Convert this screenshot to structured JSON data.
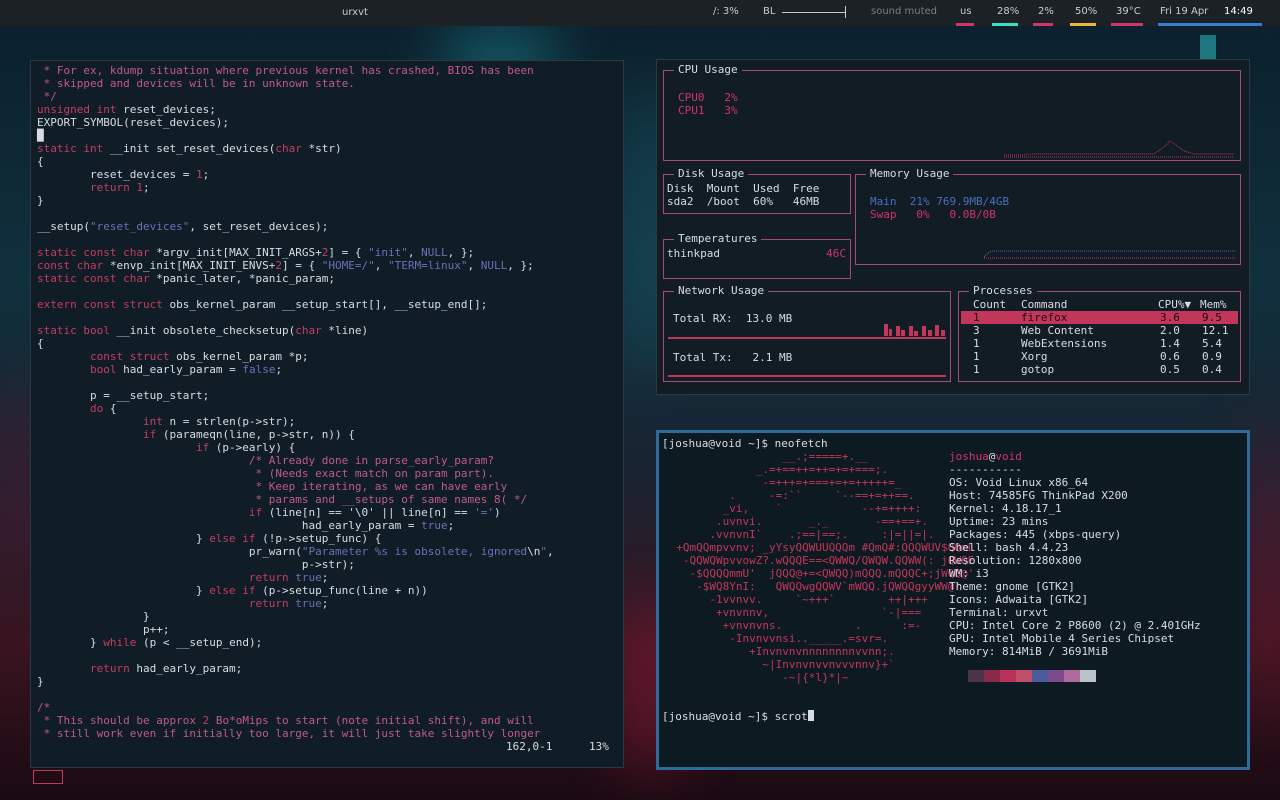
{
  "bar": {
    "window_title": "urxvt",
    "disk": "/: 3%",
    "bl_label": "BL",
    "sound": "sound muted",
    "layout": "us",
    "cpu1": "28%",
    "cpu2": "2%",
    "bat": "50%",
    "temp": "39°C",
    "date": "Fri 19 Apr",
    "time": "14:49"
  },
  "vim": {
    "lines": [
      [
        [
          "c-com",
          " * For ex, kdump situation where previous kernel has crashed, BIOS has been"
        ]
      ],
      [
        [
          "c-com",
          " * skipped and devices will be in unknown state."
        ]
      ],
      [
        [
          "c-com",
          " */"
        ]
      ],
      [
        [
          "c-kw",
          "unsigned int"
        ],
        [
          "c-plain",
          " reset_devices;"
        ]
      ],
      [
        [
          "c-plain",
          "EXPORT_SYMBOL(reset_devices);"
        ]
      ],
      [
        [
          "c-plain",
          "█"
        ]
      ],
      [
        [
          "c-kw",
          "static int"
        ],
        [
          "c-plain",
          " __init set_reset_devices("
        ],
        [
          "c-kw",
          "char"
        ],
        [
          "c-plain",
          " *str)"
        ]
      ],
      [
        [
          "c-plain",
          "{"
        ]
      ],
      [
        [
          "c-plain",
          "        reset_devices = "
        ],
        [
          "c-num",
          "1"
        ],
        [
          "c-plain",
          ";"
        ]
      ],
      [
        [
          "c-kw",
          "        return "
        ],
        [
          "c-num",
          "1"
        ],
        [
          "c-plain",
          ";"
        ]
      ],
      [
        [
          "c-plain",
          "}"
        ]
      ],
      [
        [
          "c-plain",
          ""
        ]
      ],
      [
        [
          "c-plain",
          "__setup("
        ],
        [
          "c-str",
          "\"reset_devices\""
        ],
        [
          "c-plain",
          ", set_reset_devices);"
        ]
      ],
      [
        [
          "c-plain",
          ""
        ]
      ],
      [
        [
          "c-kw",
          "static const char"
        ],
        [
          "c-plain",
          " *argv_init[MAX_INIT_ARGS+"
        ],
        [
          "c-num",
          "2"
        ],
        [
          "c-plain",
          "] = { "
        ],
        [
          "c-str",
          "\"init\""
        ],
        [
          "c-plain",
          ", "
        ],
        [
          "c-str",
          "NULL"
        ],
        [
          "c-plain",
          ", };"
        ]
      ],
      [
        [
          "c-kw",
          "const char"
        ],
        [
          "c-plain",
          " *envp_init[MAX_INIT_ENVS+"
        ],
        [
          "c-num",
          "2"
        ],
        [
          "c-plain",
          "] = { "
        ],
        [
          "c-str",
          "\"HOME=/\""
        ],
        [
          "c-plain",
          ", "
        ],
        [
          "c-str",
          "\"TERM=linux\""
        ],
        [
          "c-plain",
          ", "
        ],
        [
          "c-str",
          "NULL"
        ],
        [
          "c-plain",
          ", };"
        ]
      ],
      [
        [
          "c-kw",
          "static const char"
        ],
        [
          "c-plain",
          " *panic_later, *panic_param;"
        ]
      ],
      [
        [
          "c-plain",
          ""
        ]
      ],
      [
        [
          "c-kw",
          "extern const struct"
        ],
        [
          "c-plain",
          " obs_kernel_param __setup_start[], __setup_end[];"
        ]
      ],
      [
        [
          "c-plain",
          ""
        ]
      ],
      [
        [
          "c-kw",
          "static bool"
        ],
        [
          "c-plain",
          " __init obsolete_checksetup("
        ],
        [
          "c-kw",
          "char"
        ],
        [
          "c-plain",
          " *line)"
        ]
      ],
      [
        [
          "c-plain",
          "{"
        ]
      ],
      [
        [
          "c-kw",
          "        const struct"
        ],
        [
          "c-plain",
          " obs_kernel_param *p;"
        ]
      ],
      [
        [
          "c-kw",
          "        bool"
        ],
        [
          "c-plain",
          " had_early_param = "
        ],
        [
          "c-str",
          "false"
        ],
        [
          "c-plain",
          ";"
        ]
      ],
      [
        [
          "c-plain",
          ""
        ]
      ],
      [
        [
          "c-plain",
          "        p = __setup_start;"
        ]
      ],
      [
        [
          "c-kw",
          "        do"
        ],
        [
          "c-plain",
          " {"
        ]
      ],
      [
        [
          "c-kw",
          "                int"
        ],
        [
          "c-plain",
          " n = strlen(p->str);"
        ]
      ],
      [
        [
          "c-kw",
          "                if"
        ],
        [
          "c-plain",
          " (parameqn(line, p->str, n)) {"
        ]
      ],
      [
        [
          "c-kw",
          "                        if"
        ],
        [
          "c-plain",
          " (p->early) {"
        ]
      ],
      [
        [
          "c-com",
          "                                /* Already done in parse_early_param?"
        ]
      ],
      [
        [
          "c-com",
          "                                 * (Needs exact match on param part)."
        ]
      ],
      [
        [
          "c-com",
          "                                 * Keep iterating, as we can have early"
        ]
      ],
      [
        [
          "c-com",
          "                                 * params and __setups of same names 8( */"
        ]
      ],
      [
        [
          "c-kw",
          "                                if"
        ],
        [
          "c-plain",
          " (line[n] == "
        ],
        [
          "c-plain",
          "'\\0'"
        ],
        [
          "c-plain",
          " || line[n] == "
        ],
        [
          "c-str",
          "'='"
        ],
        [
          "c-plain",
          ")"
        ]
      ],
      [
        [
          "c-plain",
          "                                        had_early_param = "
        ],
        [
          "c-str",
          "true"
        ],
        [
          "c-plain",
          ";"
        ]
      ],
      [
        [
          "c-plain",
          "                        } "
        ],
        [
          "c-kw",
          "else if"
        ],
        [
          "c-plain",
          " (!p->setup_func) {"
        ]
      ],
      [
        [
          "c-plain",
          "                                pr_warn("
        ],
        [
          "c-str",
          "\"Parameter %s is obsolete, ignored"
        ],
        [
          "c-plain",
          "\\n"
        ],
        [
          "c-str",
          "\""
        ],
        [
          "c-plain",
          ","
        ]
      ],
      [
        [
          "c-plain",
          "                                        p->str);"
        ]
      ],
      [
        [
          "c-kw",
          "                                return "
        ],
        [
          "c-str",
          "true"
        ],
        [
          "c-plain",
          ";"
        ]
      ],
      [
        [
          "c-plain",
          "                        } "
        ],
        [
          "c-kw",
          "else if"
        ],
        [
          "c-plain",
          " (p->setup_func(line + n))"
        ]
      ],
      [
        [
          "c-kw",
          "                                return "
        ],
        [
          "c-str",
          "true"
        ],
        [
          "c-plain",
          ";"
        ]
      ],
      [
        [
          "c-plain",
          "                }"
        ]
      ],
      [
        [
          "c-plain",
          "                p++;"
        ]
      ],
      [
        [
          "c-plain",
          "        } "
        ],
        [
          "c-kw",
          "while"
        ],
        [
          "c-plain",
          " (p < __setup_end);"
        ]
      ],
      [
        [
          "c-plain",
          ""
        ]
      ],
      [
        [
          "c-kw",
          "        return"
        ],
        [
          "c-plain",
          " had_early_param;"
        ]
      ],
      [
        [
          "c-plain",
          "}"
        ]
      ],
      [
        [
          "c-plain",
          ""
        ]
      ],
      [
        [
          "c-com",
          "/*"
        ]
      ],
      [
        [
          "c-com",
          " * This should be approx "
        ],
        [
          "c-num",
          "2"
        ],
        [
          "c-com",
          " Bo*oMips to start (note initial shift), and will"
        ]
      ],
      [
        [
          "c-com",
          " * still work even if initially too large, it will just take slightly longer"
        ]
      ]
    ],
    "status_pos": "162,0-1",
    "status_pct": "13%"
  },
  "gotop": {
    "cpu_label": "CPU Usage",
    "cpu_rows": [
      "CPU0   2%",
      "CPU1   3%"
    ],
    "disk_label": "Disk Usage",
    "disk_header": "Disk  Mount  Used  Free",
    "disk_row": "sda2  /boot  60%   46MB",
    "mem_label": "Memory Usage",
    "mem_main": "Main  21% 769.9MB/4GB",
    "mem_swap": "Swap   0%   0.0B/0B",
    "temp_label": "Temperatures",
    "temp_name": "thinkpad",
    "temp_val": "46C",
    "net_label": "Network Usage",
    "rx": "Total RX:  13.0 MB",
    "tx": "Total Tx:   2.1 MB",
    "proc_label": "Processes",
    "proc_header": {
      "count": "Count",
      "cmd": "Command",
      "cpu": "CPU%▼",
      "mem": "Mem%"
    },
    "procs": [
      {
        "count": "1",
        "cmd": "firefox",
        "cpu": "3.6",
        "mem": "9.5"
      },
      {
        "count": "3",
        "cmd": "Web Content",
        "cpu": "2.0",
        "mem": "12.1"
      },
      {
        "count": "1",
        "cmd": "WebExtensions",
        "cpu": "1.4",
        "mem": "5.4"
      },
      {
        "count": "1",
        "cmd": "Xorg",
        "cpu": "0.6",
        "mem": "0.9"
      },
      {
        "count": "1",
        "cmd": "gotop",
        "cpu": "0.5",
        "mem": "0.4"
      }
    ]
  },
  "neofetch": {
    "prompt1": "[joshua@void ~]$ neofetch",
    "user": "joshua",
    "at": "@",
    "host": "void",
    "sep": "-----------",
    "info": [
      "OS: Void Linux x86_64",
      "Host: 74585FG ThinkPad X200",
      "Kernel: 4.18.17_1",
      "Uptime: 23 mins",
      "Packages: 445 (xbps-query)",
      "Shell: bash 4.4.23",
      "Resolution: 1280x800",
      "WM: i3",
      "Theme: gnome [GTK2]",
      "Icons: Adwaita [GTK2]",
      "Terminal: urxvt",
      "CPU: Intel Core 2 P8600 (2) @ 2.401GHz",
      "GPU: Intel Mobile 4 Series Chipset",
      "Memory: 814MiB / 3691MiB"
    ],
    "ascii": [
      "                  __.;=====+.__",
      "              _.=+==++=++=+=+===;.",
      "               -=+++=+===+=+=+++++=_",
      "          .     -=:``     `--==+=++==.",
      "         _vi,    `            --+=++++:",
      "        .uvnvi.       _._       -==+==+.",
      "       .vvnvnI`    .;==|==;.     :|=||=|.",
      "  +QmQQmpvvnv; _yYsyQQWUUQQQm #QmQ#:QQQWUV$QQmL",
      "   -QQWQWpvvowZ?.wQQQE==<QWWQ/QWQW.QQWW(: jQWQE",
      "    -$QQQQmmU'  jQQQ@+=<QWQQ)mQQQ.mQQQC+;jWQQ@'",
      "     -$WQ8YnI:   QWQQwgQQWV`mWQQ.jQWQQgyyWW@!",
      "       -1vvnvv.     `~+++`        ++|+++",
      "        +vnvnnv,                 `-|===",
      "         +vnvnvns.           .      :=-",
      "          -Invnvvnsi.._____.=svr=.",
      "             +Invnvnvnnnnnnnnvvnn;.",
      "               ~|Invnvnvvnvvvnnv}+`",
      "                  -~|{*l}*|~"
    ],
    "swatches": [
      "#4a3448",
      "#8a2a48",
      "#b8325a",
      "#c0506a",
      "#4a5a9a",
      "#7a4a8a",
      "#b06aa0",
      "#b8c4c8"
    ],
    "prompt2": "[joshua@void ~]$ scrot"
  }
}
